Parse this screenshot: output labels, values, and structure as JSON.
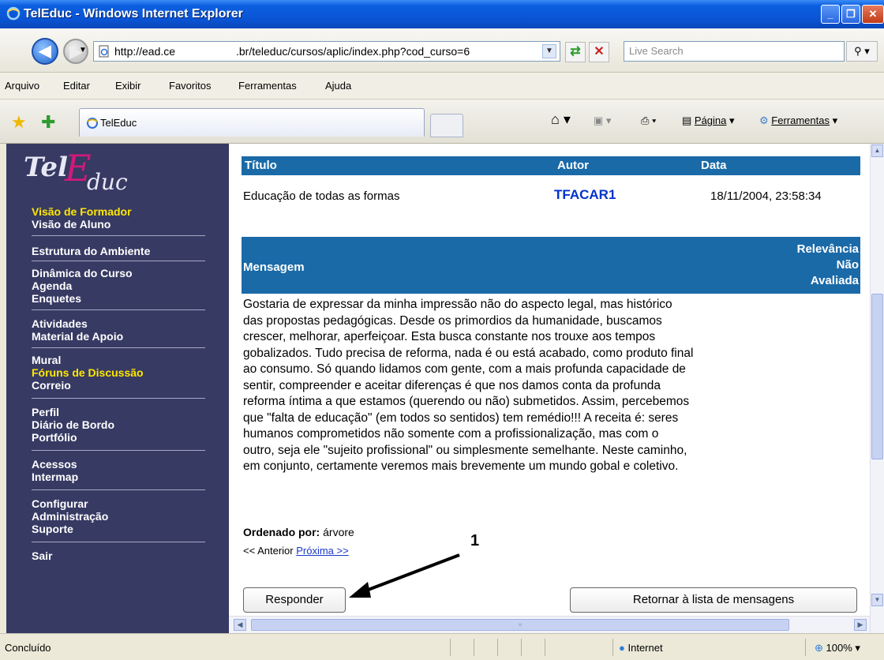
{
  "window": {
    "title": "TelEduc - Windows Internet Explorer"
  },
  "address": {
    "url_part1": "http://ead.ce",
    "url_part2": ".br/teleduc/cursos/aplic/index.php?cod_curso=6",
    "search_placeholder": "Live Search"
  },
  "menubar": [
    "Arquivo",
    "Editar",
    "Exibir",
    "Favoritos",
    "Ferramentas",
    "Ajuda"
  ],
  "tab": {
    "label": "TelEduc"
  },
  "commandbar": {
    "page_label": "Página",
    "tools_label": "Ferramentas"
  },
  "leftnav": {
    "view_formador": "Visão de Formador",
    "view_aluno": "Visão de Aluno",
    "groups": [
      [
        "Estrutura do Ambiente"
      ],
      [
        "Dinâmica do Curso",
        "Agenda",
        "Enquetes"
      ],
      [
        "Atividades",
        "Material de Apoio"
      ],
      [
        "Mural",
        "Fóruns de Discussão",
        "Correio"
      ],
      [
        "Perfil",
        "Diário de Bordo",
        "Portfólio"
      ],
      [
        "Acessos",
        "Intermap"
      ],
      [
        "Configurar",
        "Administração",
        "Suporte"
      ],
      [
        "Sair"
      ]
    ]
  },
  "message": {
    "col_title": "Título",
    "col_author": "Autor",
    "col_date": "Data",
    "title": "Educação de todas as formas",
    "author": "TFACAR1",
    "date": "18/11/2004, 23:58:34",
    "msg_header": "Mensagem",
    "relevance_l1": "Relevância",
    "relevance_l2": "Não",
    "relevance_l3": "Avaliada",
    "body": [
      "Gostaria de expressar da minha impressão não do aspecto legal, mas histórico",
      "das propostas pedagógicas. Desde os primordios da humanidade, buscamos",
      "crescer, melhorar, aperfeiçoar. Esta busca constante nos trouxe aos tempos",
      "gobalizados. Tudo precisa de reforma, nada é ou está acabado, como produto final",
      "ao consumo. Só quando lidamos com gente, com a mais profunda capacidade de",
      "sentir, compreender e aceitar diferenças é que nos damos conta da profunda",
      "reforma íntima a que estamos (querendo ou não) submetidos. Assim, percebemos",
      "que \"falta de educação\" (em todos so sentidos) tem remédio!!! A receita é: seres",
      "humanos comprometidos não somente com a profissionalização, mas com o",
      "outro, seja ele \"sujeito profissional\" ou simplesmente semelhante. Neste caminho,",
      "em conjunto, certamente veremos mais brevemente um mundo gobal e coletivo."
    ],
    "ordered_label": "Ordenado por:",
    "ordered_value": "árvore",
    "prev": "<< Anterior",
    "next": "Próxima >>",
    "reply_button": "Responder",
    "return_button": "Retornar à lista de mensagens"
  },
  "annotation": {
    "number": "1"
  },
  "status": {
    "text": "Concluído",
    "zone": "Internet",
    "zoom": "100%"
  }
}
